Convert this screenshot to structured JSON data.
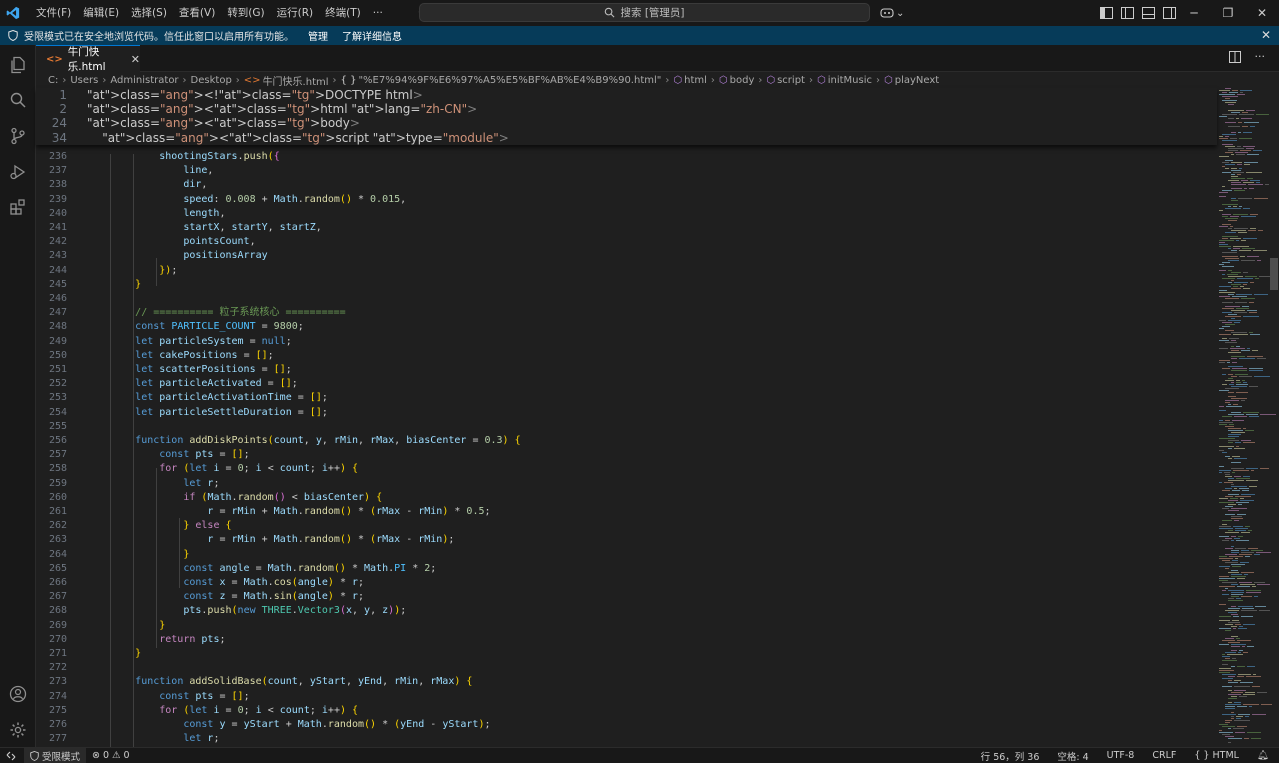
{
  "titlebar": {
    "menu": [
      "文件(F)",
      "编辑(E)",
      "选择(S)",
      "查看(V)",
      "转到(G)",
      "运行(R)",
      "终端(T)",
      "···"
    ],
    "search_placeholder": "搜索 [管理员]",
    "window_controls": [
      "minimize",
      "restore",
      "close"
    ]
  },
  "banner": {
    "message": "受限模式已在安全地浏览代码。信任此窗口以启用所有功能。",
    "manage": "管理",
    "learn_more": "了解详细信息"
  },
  "tab": {
    "label": "牛门快乐.html"
  },
  "breadcrumb": {
    "segments": [
      "C:",
      "Users",
      "Administrator",
      "Desktop"
    ],
    "file": "牛门快乐.html",
    "symbols": [
      "\"%E7%94%9F%E6%97%A5%E5%BF%AB%E4%B9%90.html\"",
      "html",
      "body",
      "script",
      "initMusic",
      "playNext"
    ]
  },
  "sticky_lines": [
    {
      "n": "1",
      "code": "<!DOCTYPE html>"
    },
    {
      "n": "2",
      "code": "<html lang=\"zh-CN\">"
    },
    {
      "n": "24",
      "code": "<body>"
    },
    {
      "n": "34",
      "code": "    <script type=\"module\">"
    }
  ],
  "code_lines": [
    {
      "n": "235",
      "code": ""
    },
    {
      "n": "236",
      "code": "            shootingStars.push({"
    },
    {
      "n": "237",
      "code": "                line,"
    },
    {
      "n": "238",
      "code": "                dir,"
    },
    {
      "n": "239",
      "code": "                speed: 0.008 + Math.random() * 0.015,"
    },
    {
      "n": "240",
      "code": "                length,"
    },
    {
      "n": "241",
      "code": "                startX, startY, startZ,"
    },
    {
      "n": "242",
      "code": "                pointsCount,"
    },
    {
      "n": "243",
      "code": "                positionsArray"
    },
    {
      "n": "244",
      "code": "            });"
    },
    {
      "n": "245",
      "code": "        }"
    },
    {
      "n": "246",
      "code": ""
    },
    {
      "n": "247",
      "code": "        // ========== 粒子系统核心 =========="
    },
    {
      "n": "248",
      "code": "        const PARTICLE_COUNT = 9800;"
    },
    {
      "n": "249",
      "code": "        let particleSystem = null;"
    },
    {
      "n": "250",
      "code": "        let cakePositions = [];"
    },
    {
      "n": "251",
      "code": "        let scatterPositions = [];"
    },
    {
      "n": "252",
      "code": "        let particleActivated = [];"
    },
    {
      "n": "253",
      "code": "        let particleActivationTime = [];"
    },
    {
      "n": "254",
      "code": "        let particleSettleDuration = [];"
    },
    {
      "n": "255",
      "code": ""
    },
    {
      "n": "256",
      "code": "        function addDiskPoints(count, y, rMin, rMax, biasCenter = 0.3) {"
    },
    {
      "n": "257",
      "code": "            const pts = [];"
    },
    {
      "n": "258",
      "code": "            for (let i = 0; i < count; i++) {"
    },
    {
      "n": "259",
      "code": "                let r;"
    },
    {
      "n": "260",
      "code": "                if (Math.random() < biasCenter) {"
    },
    {
      "n": "261",
      "code": "                    r = rMin + Math.random() * (rMax - rMin) * 0.5;"
    },
    {
      "n": "262",
      "code": "                } else {"
    },
    {
      "n": "263",
      "code": "                    r = rMin + Math.random() * (rMax - rMin);"
    },
    {
      "n": "264",
      "code": "                }"
    },
    {
      "n": "265",
      "code": "                const angle = Math.random() * Math.PI * 2;"
    },
    {
      "n": "266",
      "code": "                const x = Math.cos(angle) * r;"
    },
    {
      "n": "267",
      "code": "                const z = Math.sin(angle) * r;"
    },
    {
      "n": "268",
      "code": "                pts.push(new THREE.Vector3(x, y, z));"
    },
    {
      "n": "269",
      "code": "            }"
    },
    {
      "n": "270",
      "code": "            return pts;"
    },
    {
      "n": "271",
      "code": "        }"
    },
    {
      "n": "272",
      "code": ""
    },
    {
      "n": "273",
      "code": "        function addSolidBase(count, yStart, yEnd, rMin, rMax) {"
    },
    {
      "n": "274",
      "code": "            const pts = [];"
    },
    {
      "n": "275",
      "code": "            for (let i = 0; i < count; i++) {"
    },
    {
      "n": "276",
      "code": "                const y = yStart + Math.random() * (yEnd - yStart);"
    },
    {
      "n": "277",
      "code": "                let r;"
    }
  ],
  "statusbar": {
    "restricted": "受限模式",
    "errors": "0",
    "warnings": "0",
    "position": "行 56，列 36",
    "spaces": "空格: 4",
    "encoding": "UTF-8",
    "eol": "CRLF",
    "language": "HTML"
  }
}
